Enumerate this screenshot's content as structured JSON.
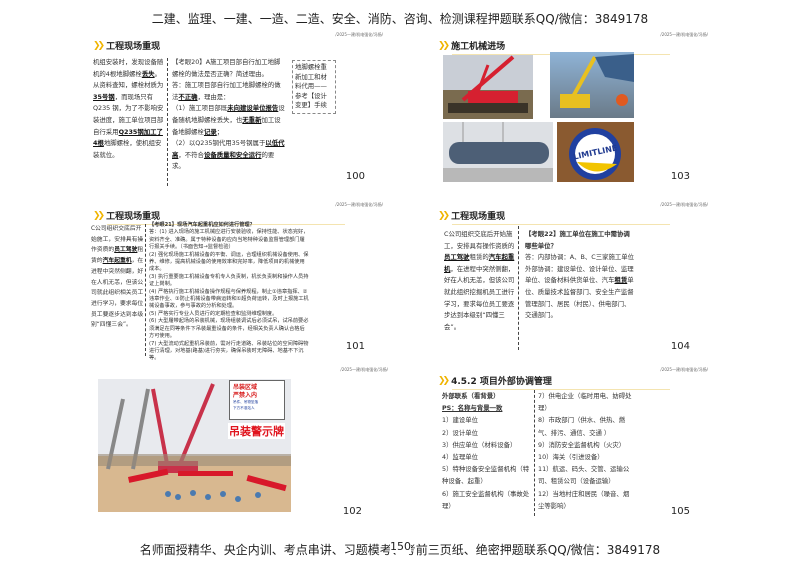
{
  "header": "二建、监理、一建、一造、二造、安全、消防、咨询、检测课程押题联系QQ/微信：3849178",
  "footer": "名师面授精华、央企内训、考点串讲、习题模考、考前三页纸、绝密押题联系QQ/微信：3849178",
  "page_number": "150",
  "subtitle": "/2025一建/机电强化/冯扬/",
  "slides": [
    {
      "num": "100",
      "title": "工程现场重现",
      "left": [
        "机组安装时，发现设备随机的4根地脚螺栓",
        "丢失",
        "。从资料查知，螺栓材质为",
        "35号钢",
        "，而现场只有Q235 钢，为了不影响安装进度，施工单位项目部自行采用",
        "Q235钢加工了4根",
        "地脚螺栓，使机组安装就位。"
      ],
      "q": "【考眼20】A施工项目部自行加工地脚螺栓的做法是否正确？简述理由。",
      "a": [
        "答：施工项目部自行加工地脚螺栓的做法",
        "不正确",
        "，理由是：",
        "（1）施工项目部既",
        "未向建设单位报告",
        "设备随机地脚螺栓丢失，也",
        "无重新",
        "加工设备地脚螺栓",
        "记录",
        "；",
        "（2）以Q235钢代用35号钢属于",
        "以低代高",
        "，不符合",
        "设备质量和安全运行",
        "的要求。"
      ],
      "note": "地脚螺栓重新加工和材料代用——参考【设计变更】手续"
    },
    {
      "num": "101",
      "title": "工程现场重现",
      "left": [
        "C公司组织交底后开始施工，安排具有操作资质的",
        "员工驾驶",
        "租赁的",
        "汽车起重机",
        "，在进程中突然侧翻，好在人机无恙，但该公司就此组织相关员工进行学习，要求每位员工要逐步达到本级别“四懂三会”。"
      ],
      "q": "【考眼21】现场汽车起重机应如何进行管理？",
      "a": [
        "答：(1) 进入现场的施工机械应进行安装验收，保持性能、状态完好，资料齐全、准确。属于特种设备的应向当地特种设备监督管理部门履行报关手续。（书面告知→监督检验）",
        "(2) 强化现场施工机械设备的平衡、调运，合理组织机械设备使用、保养、维修，提高机械设备的使用效率和完好率，降低项目的机械使用成本。",
        "(3) 执行重要施工机械设备专机专人负责制，机长负责制和操作人员持证上岗制。",
        "(4) 严格执行施工机械设备操作规程与保养规程，制止①违章指挥、②违章作业、③防止机械设备带病运转和①超负荷运转，及时上报施工机械设备事故，参与事故的分析和处理。",
        "(5) 严格实行专业人员进行的定期检查和监测维理制度。",
        "(6) 大型履带起场的吊装机械，现场组装调试后必须试吊，试吊前要必须满足在同等条件下吊装最重设备的条件，经相关负责人确认合格后方可使用。",
        "(7) 大型流动式起重机吊装前，需对行走道路、吊装站位的空间障碍物进行清理，对地基(路基)进行夯实，确保吊装时无障碍、地基不下沉等。"
      ]
    },
    {
      "num": "102",
      "sign": {
        "l1": "吊装区域",
        "l2": "严禁入内",
        "l3": "吊件、吊物坠落",
        "l4": "下方不准站人",
        "caption": "吊装警示牌"
      }
    },
    {
      "num": "103",
      "title": "施工机械进场",
      "sticker": "LIMITLINE"
    },
    {
      "num": "104",
      "title": "工程现场重现",
      "left": [
        "C公司组织交底后开始施工，安排具有操作资质的",
        "员工驾驶",
        "租赁的",
        "汽车起重机",
        "，在进程中突然侧翻，好在人机无恙，但该公司就此组织挖掘机员工进行学习，要求每位员工要逐步达到本级别“四懂三会”。"
      ],
      "q": "【考眼22】施工单位在施工中需协调哪些单位？",
      "a": [
        "答：内部协调：A、B、C三家施工单位",
        "外部协调：建设单位、设计单位、监理单位、设备材料供货单位、汽车",
        "租赁",
        "单位、质量技术监督部门、安全生产监督管理部门、居民（村民）、供电部门、交通部门。"
      ]
    },
    {
      "num": "105",
      "title": "4.5.2 项目外部协调管理",
      "left": [
        "外部联系（看背景）",
        "PS：名称与背景一致",
        "1）建设单位",
        "2）设计单位",
        "3）供应单位（材料设备）",
        "4）监理单位",
        "5）特种设备安全监督机构（特种设备、起重）",
        "6）施工安全监督机构（事故处理）"
      ],
      "right": [
        "7）供电企业（临时用电、妨碍处理）",
        "8）市政部门（供水、供热、燃气、排污、通信、交通 ）",
        "9）消防安全监督机构（火灾）",
        "10）海关（引进设备）",
        "11）航运、码头、交管、运输公司、租赁公司（设备运输）",
        "12）当地村庄和居民（噪音、烟尘等影响）"
      ]
    }
  ]
}
